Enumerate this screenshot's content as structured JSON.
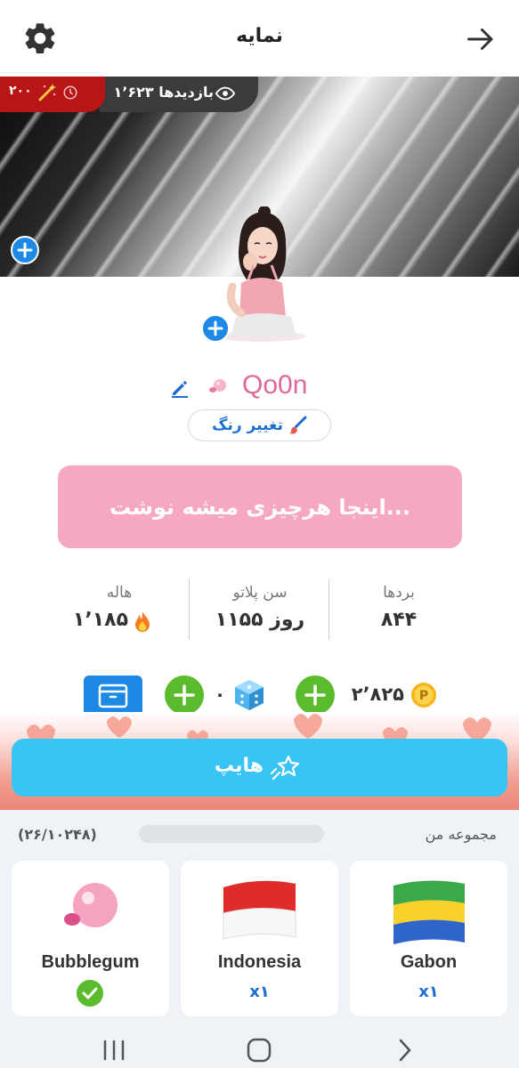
{
  "header": {
    "title": "نمایه",
    "settings_icon": "gear-icon",
    "back_icon": "arrow-right-icon"
  },
  "banner": {
    "views_label": "۱٬۶۲۳ بازدیدها",
    "boost_count": "۲۰۰",
    "eye_icon": "eye-icon",
    "wand_icon": "magic-wand-icon",
    "clock_icon": "clock-icon"
  },
  "profile": {
    "username": "Qo0n",
    "change_color_label": "تغییر رنگ",
    "bio": "اینجا هرچیزی میشه نوشت..."
  },
  "stats": [
    {
      "label": "بردها",
      "value": "۸۴۴"
    },
    {
      "label": "سن پلاتو",
      "value": "۱۱۵۵ روز"
    },
    {
      "label": "هاله",
      "value": "۱٬۱۸۵"
    }
  ],
  "currency": {
    "coins": "۲٬۸۲۵",
    "dice": "۰"
  },
  "hype": {
    "label": "هایپ"
  },
  "collection": {
    "title": "مجموعه من",
    "count": "(۲۶/۱۰۲۴۸)",
    "items": [
      {
        "name": "Gabon",
        "multiplier": "x۱"
      },
      {
        "name": "Indonesia",
        "multiplier": "x۱"
      },
      {
        "name": "Bubblegum",
        "multiplier": ""
      }
    ]
  },
  "colors": {
    "accent_blue": "#1e88e5",
    "username_pink": "#e0679a",
    "bio_pink": "#f6a8c0",
    "hype_cyan": "#38c4f4",
    "plus_green": "#5abb2d",
    "views_red": "#b81616"
  }
}
